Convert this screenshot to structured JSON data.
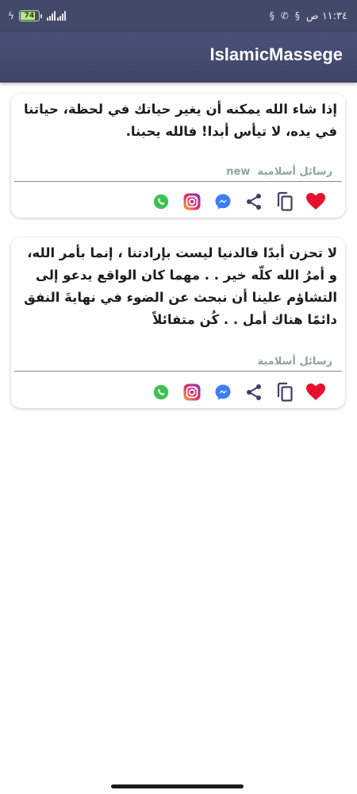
{
  "status_bar": {
    "battery": "74",
    "time": "١١:٣٤ ص",
    "network_label": "4G"
  },
  "app_bar": {
    "title": "IslamicMassege"
  },
  "cards": [
    {
      "text": "إذا شاء الله يمكنه أن يغير حياتك في لحظة، حياتنا في يده، لا تيأس أبدا! فالله يحبنا.",
      "source": "رسائل أسلامية",
      "badge": "new"
    },
    {
      "text": "لا تحزن أبدًا فالدنيا ليست بإرادتنا ، إنما بأمر الله، و أمرُ الله كلّه خير . . مهما كان الواقع يدعو إلى التشاؤم علينا أن نبحث عن الضوء في نهايةَ النفق دائمًا هناك أمل . . كُن متفائلاً",
      "source": "رسائل أسلامية",
      "badge": ""
    }
  ],
  "colors": {
    "app_bar": "#43496a",
    "heart": "#e8112d",
    "whatsapp": "#3cc152",
    "messenger": "#3b7ef2",
    "icon_dark": "#3e4060"
  },
  "icons": [
    "whatsapp-icon",
    "instagram-icon",
    "messenger-icon",
    "share-icon",
    "copy-icon",
    "heart-icon"
  ]
}
